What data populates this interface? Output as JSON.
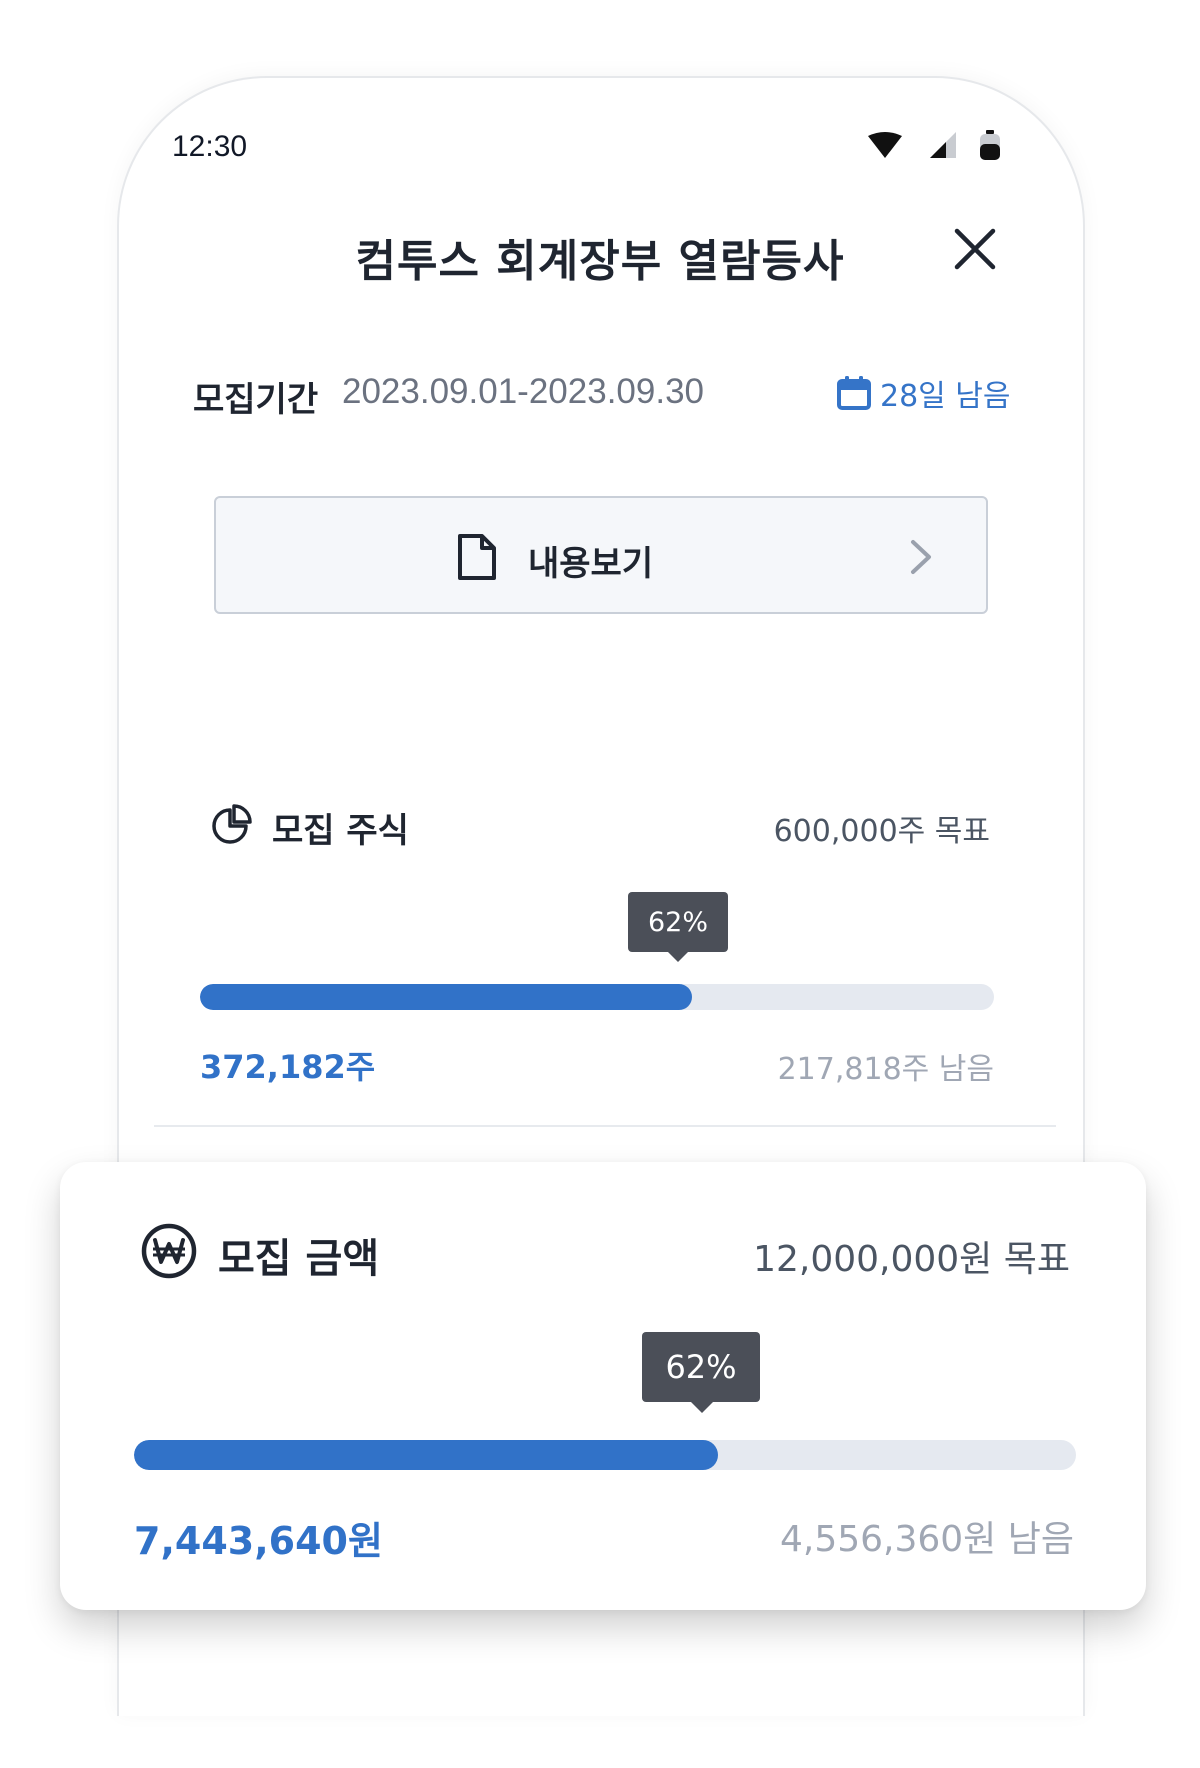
{
  "status_bar": {
    "time": "12:30",
    "icons": [
      "wifi-icon",
      "signal-icon",
      "battery-icon"
    ]
  },
  "header": {
    "title": "컴투스 회계장부 열람등사",
    "close_icon": "close-icon"
  },
  "period": {
    "label": "모집기간",
    "value": "2023.09.01-2023.09.30",
    "days_left": "28일 남음",
    "days_icon": "calendar-icon"
  },
  "view_button": {
    "label": "내용보기",
    "icon": "document-icon",
    "chevron": "chevron-right-icon"
  },
  "shares": {
    "title": "모집 주식",
    "icon": "pie-chart-icon",
    "target": "600,000주 목표",
    "percent_label": "62%",
    "progress": 0.62,
    "current": "372,182주",
    "remaining": "217,818주 남음"
  },
  "amount": {
    "title": "모집 금액",
    "icon": "won-icon",
    "target": "12,000,000원 목표",
    "percent_label": "62%",
    "progress": 0.62,
    "current": "7,443,640원",
    "remaining": "4,556,360원 남음"
  },
  "colors": {
    "accent": "#3172c8",
    "track": "#e5e9f0",
    "tooltip": "#4b4f58",
    "muted": "#a0a7b4"
  }
}
